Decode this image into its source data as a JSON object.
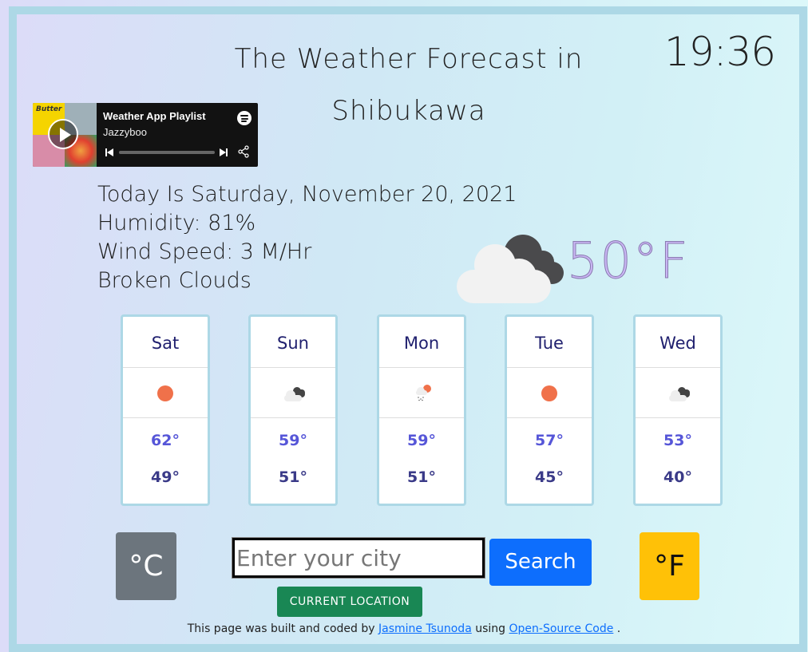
{
  "header": {
    "title_line1": "The Weather Forecast in",
    "title_line2": "Shibukawa",
    "clock": "19:36"
  },
  "spotify": {
    "playlist_title": "Weather App Playlist",
    "owner": "Jazzyboo",
    "album_art_text": "Butter"
  },
  "current": {
    "date_line": "Today Is Saturday, November 20, 2021",
    "humidity_line": "Humidity: 81%",
    "wind_line": "Wind Speed: 3 M/Hr",
    "description": "Broken Clouds",
    "temperature": "50°F",
    "icon": "broken-clouds-icon"
  },
  "forecast": [
    {
      "day": "Sat",
      "icon": "sun-icon",
      "high": "62°",
      "low": "49°"
    },
    {
      "day": "Sun",
      "icon": "broken-clouds-icon",
      "high": "59°",
      "low": "51°"
    },
    {
      "day": "Mon",
      "icon": "rain-sun-icon",
      "high": "59°",
      "low": "51°"
    },
    {
      "day": "Tue",
      "icon": "sun-icon",
      "high": "57°",
      "low": "45°"
    },
    {
      "day": "Wed",
      "icon": "broken-clouds-icon",
      "high": "53°",
      "low": "40°"
    }
  ],
  "controls": {
    "celsius_label": "°C",
    "fahrenheit_label": "°F",
    "city_placeholder": "Enter your city",
    "city_value": "",
    "search_label": "Search",
    "current_location_label": "CURRENT LOCATION"
  },
  "footer": {
    "prefix": "This page was built and coded by",
    "author_link": "Jasmine Tsunoda",
    "middle": "using",
    "source_link": "Open-Source Code",
    "suffix": "."
  },
  "colors": {
    "frame_border": "#add8e6",
    "celsius_button": "#6c757d",
    "fahrenheit_button": "#ffc107",
    "search_button": "#0d6efd",
    "location_button": "#198754",
    "current_temp": "#c9b6f4",
    "sun": "#f0714a"
  }
}
